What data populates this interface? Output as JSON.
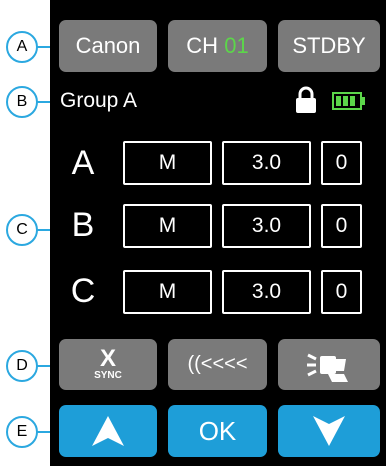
{
  "callouts": [
    "A",
    "B",
    "C",
    "D",
    "E"
  ],
  "top_bar": {
    "brand_label": "Canon",
    "channel_label": "CH",
    "channel_value": "01",
    "mode_label": "STDBY"
  },
  "group": {
    "label": "Group A",
    "lock_icon": "lock-icon",
    "battery_icon": "battery-icon"
  },
  "groups": [
    {
      "name": "A",
      "mode": "M",
      "power": "3.0",
      "value": "0"
    },
    {
      "name": "B",
      "mode": "M",
      "power": "3.0",
      "value": "0"
    },
    {
      "name": "C",
      "mode": "M",
      "power": "3.0",
      "value": "0"
    }
  ],
  "function_bar": {
    "sync_icon_label": "X",
    "sync_label": "SYNC",
    "zoom_label": "((<<<<",
    "modeling_icon": "modeling-light-icon"
  },
  "nav_bar": {
    "up_icon": "arrow-up-icon",
    "ok_label": "OK",
    "down_icon": "arrow-down-icon"
  },
  "colors": {
    "accent_blue": "#1e9ed8",
    "button_gray": "#7a7a7a",
    "highlight_green": "#5cd64a",
    "background": "#000000"
  }
}
